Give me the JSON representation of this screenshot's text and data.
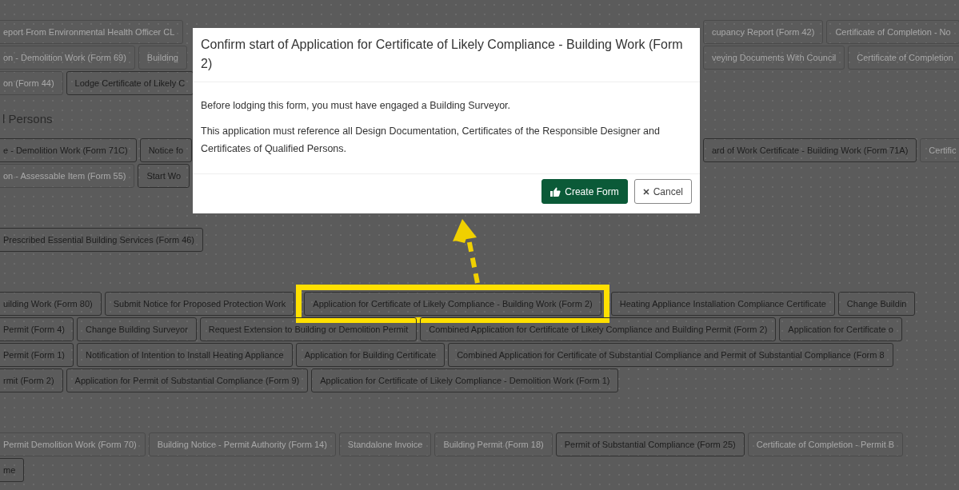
{
  "sections": [
    {
      "rows": [
        {
          "left": [
            {
              "label": "eport From Environmental Health Officer CL",
              "disabled": true
            }
          ],
          "right": [
            {
              "label": "cupancy Report (Form 42)",
              "disabled": true
            },
            {
              "label": "Certificate of Completion - No",
              "disabled": true
            }
          ]
        },
        {
          "left": [
            {
              "label": "on - Demolition Work (Form 69)",
              "disabled": true
            },
            {
              "label": "Building",
              "disabled": true
            }
          ],
          "right": [
            {
              "label": "veying Documents With Council",
              "disabled": true
            },
            {
              "label": "Certificate of Completion",
              "disabled": true
            }
          ]
        },
        {
          "left": [
            {
              "label": "on (Form 44)",
              "disabled": true
            },
            {
              "label": "Lodge Certificate of Likely C",
              "disabled": false
            }
          ]
        }
      ]
    },
    {
      "heading": "l Persons",
      "rows": [
        {
          "left": [
            {
              "label": "e - Demolition Work (Form 71C)",
              "disabled": false
            },
            {
              "label": "Notice fo",
              "disabled": false
            }
          ],
          "right": [
            {
              "label": "ard of Work Certificate - Building Work (Form 71A)",
              "disabled": false
            },
            {
              "label": "Certific",
              "disabled": true
            }
          ]
        },
        {
          "left": [
            {
              "label": "on - Assessable Item (Form 55)",
              "disabled": true
            },
            {
              "label": "Start Wo",
              "disabled": false
            }
          ]
        }
      ]
    },
    {
      "rows": [
        {
          "left": [
            {
              "label": "Prescribed Essential Building Services (Form 46)",
              "disabled": false
            }
          ]
        }
      ]
    },
    {
      "rows": [
        {
          "left": [
            {
              "label": "uilding Work (Form 80)",
              "disabled": false
            },
            {
              "label": "Submit Notice for Proposed Protection Work",
              "disabled": false
            },
            {
              "label": "Application for Certificate of Likely Compliance - Building Work (Form 2)",
              "disabled": false,
              "highlighted": true
            },
            {
              "label": "Heating Appliance Installation Compliance Certificate",
              "disabled": false
            },
            {
              "label": "Change Buildin",
              "disabled": false
            }
          ]
        },
        {
          "left": [
            {
              "label": "Permit (Form 4)",
              "disabled": false
            },
            {
              "label": "Change Building Surveyor",
              "disabled": false
            },
            {
              "label": "Request Extension to Building or Demolition Permit",
              "disabled": false
            },
            {
              "label": "Combined Application for Certificate of Likely Compliance and Building Permit (Form 2)",
              "disabled": false
            },
            {
              "label": "Application for Certificate o",
              "disabled": false
            }
          ]
        },
        {
          "left": [
            {
              "label": "Permit (Form 1)",
              "disabled": false
            },
            {
              "label": "Notification of Intention to Install Heating Appliance",
              "disabled": false
            },
            {
              "label": "Application for Building Certificate",
              "disabled": false
            },
            {
              "label": "Combined Application for Certificate of Substantial Compliance and Permit of Substantial Compliance (Form 8",
              "disabled": false
            }
          ]
        },
        {
          "left": [
            {
              "label": "rmit (Form 2)",
              "disabled": false
            },
            {
              "label": "Application for Permit of Substantial Compliance (Form 9)",
              "disabled": false
            },
            {
              "label": "Application for Certificate of Likely Compliance - Demolition Work (Form 1)",
              "disabled": false
            }
          ]
        }
      ]
    },
    {
      "rows": [
        {
          "left": [
            {
              "label": "Permit Demolition Work (Form 70)",
              "disabled": true
            },
            {
              "label": "Building Notice - Permit Authority (Form 14)",
              "disabled": true
            },
            {
              "label": "Standalone Invoice",
              "disabled": true
            },
            {
              "label": "Building Permit (Form 18)",
              "disabled": true
            },
            {
              "label": "Permit of Substantial Compliance (Form 25)",
              "disabled": false
            },
            {
              "label": "Certificate of Completion - Permit B",
              "disabled": true
            }
          ]
        },
        {
          "left": [
            {
              "label": "me",
              "disabled": false
            }
          ]
        }
      ]
    }
  ],
  "dialog": {
    "title": "Confirm start of Application for Certificate of Likely Compliance - Building Work (Form 2)",
    "paragraphs": [
      "Before lodging this form, you must have engaged a Building Surveyor.",
      "This application must reference all Design Documentation, Certificates of the Responsible Designer and Certificates of Qualified Persons."
    ],
    "buttons": [
      {
        "label": "Create Form",
        "kind": "primary"
      },
      {
        "label": "Cancel",
        "kind": "cancel"
      }
    ]
  }
}
